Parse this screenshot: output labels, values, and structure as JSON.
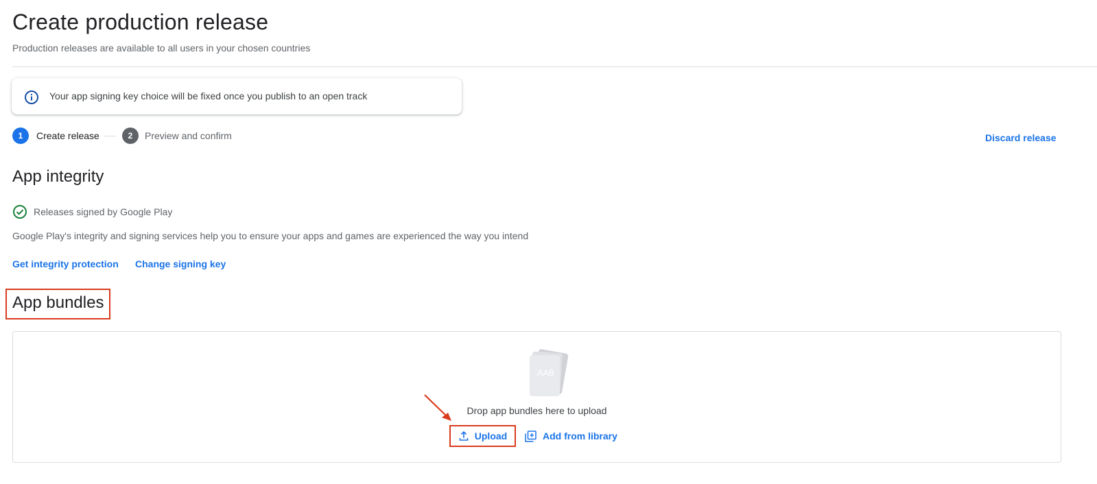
{
  "header": {
    "title": "Create production release",
    "subtitle": "Production releases are available to all users in your chosen countries"
  },
  "info_banner": {
    "icon": "info-icon",
    "text": "Your app signing key choice will be fixed once you publish to an open track"
  },
  "stepper": {
    "steps": [
      {
        "number": "1",
        "label": "Create release",
        "state": "active"
      },
      {
        "number": "2",
        "label": "Preview and confirm",
        "state": "inactive"
      }
    ]
  },
  "actions": {
    "discard_label": "Discard release"
  },
  "app_integrity": {
    "heading": "App integrity",
    "status_icon": "check-circle-icon",
    "status_label": "Releases signed by Google Play",
    "description": "Google Play's integrity and signing services help you to ensure your apps and games are experienced the way you intend",
    "links": [
      {
        "label": "Get integrity protection"
      },
      {
        "label": "Change signing key"
      }
    ]
  },
  "app_bundles": {
    "heading": "App bundles",
    "file_graphic_label": ".AAB",
    "drop_text": "Drop app bundles here to upload",
    "upload_label": "Upload",
    "upload_icon": "upload-icon",
    "library_label": "Add from library",
    "library_icon": "add-library-icon"
  },
  "colors": {
    "accent": "#1a73e8",
    "success": "#188038",
    "annotation": "#d93a1b",
    "text_primary": "#202124",
    "text_secondary": "#5f6368"
  }
}
